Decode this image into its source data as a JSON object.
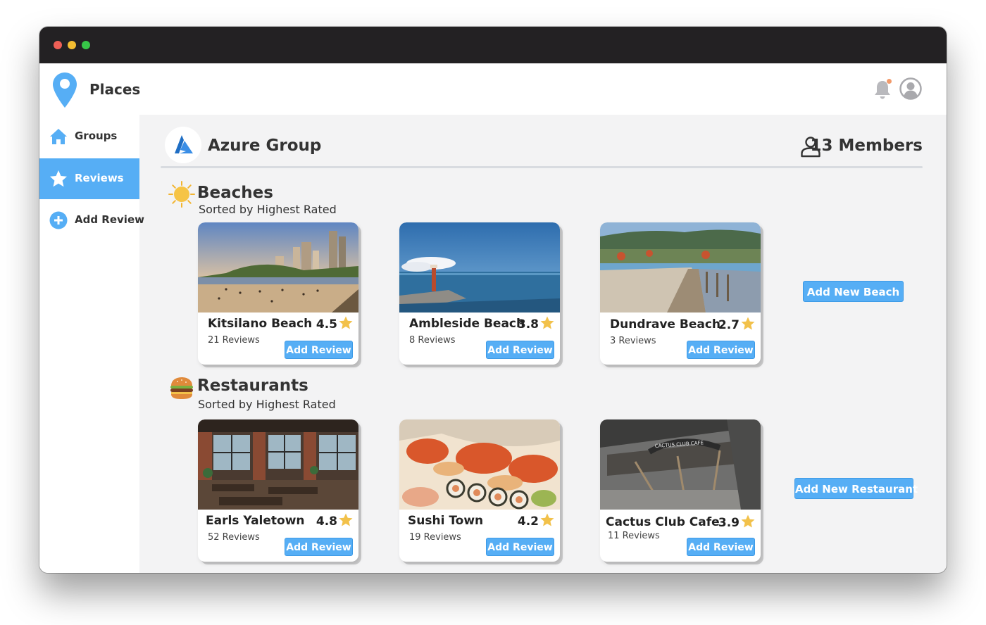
{
  "app": {
    "title": "Places"
  },
  "colors": {
    "accent": "#56aef5",
    "titlebar": "#232123",
    "star": "#f2c14a"
  },
  "icons": {
    "logo": "map-pin-icon",
    "bell": "bell-icon",
    "avatar": "user-avatar-icon",
    "groups": "home-icon",
    "reviews": "star-icon",
    "add_review": "plus-circle-icon",
    "group_logo": "azure-logo",
    "members": "person-icon",
    "beaches": "sun-icon",
    "restaurants": "burger-icon"
  },
  "sidebar": {
    "items": [
      {
        "label": "Groups",
        "icon": "home-icon",
        "active": false
      },
      {
        "label": "Reviews",
        "icon": "star-icon",
        "active": true
      },
      {
        "label": "Add Review",
        "icon": "plus-circle-icon",
        "active": false
      }
    ]
  },
  "group": {
    "name": "Azure Group",
    "members": "13 Members"
  },
  "sections": [
    {
      "title": "Beaches",
      "subtitle": "Sorted by Highest Rated",
      "add_label": "Add New Beach",
      "places": [
        {
          "name": "Kitsilano Beach",
          "rating": "4.5",
          "reviews": "21 Reviews",
          "button": "Add Review"
        },
        {
          "name": "Ambleside Beach",
          "rating": "3.8",
          "reviews": "8 Reviews",
          "button": "Add Review"
        },
        {
          "name": "Dundrave Beach",
          "rating": "2.7",
          "reviews": "3 Reviews",
          "button": "Add Review"
        }
      ]
    },
    {
      "title": "Restaurants",
      "subtitle": "Sorted by Highest Rated",
      "add_label": "Add New Restaurant",
      "places": [
        {
          "name": "Earls Yaletown",
          "rating": "4.8",
          "reviews": "52 Reviews",
          "button": "Add Review"
        },
        {
          "name": "Sushi Town",
          "rating": "4.2",
          "reviews": "19 Reviews",
          "button": "Add Review"
        },
        {
          "name": "Cactus Club Cafe",
          "rating": "3.9",
          "reviews": "11 Reviews",
          "button": "Add Review",
          "sign": "CACTUS CLUB CAFE"
        }
      ]
    }
  ]
}
